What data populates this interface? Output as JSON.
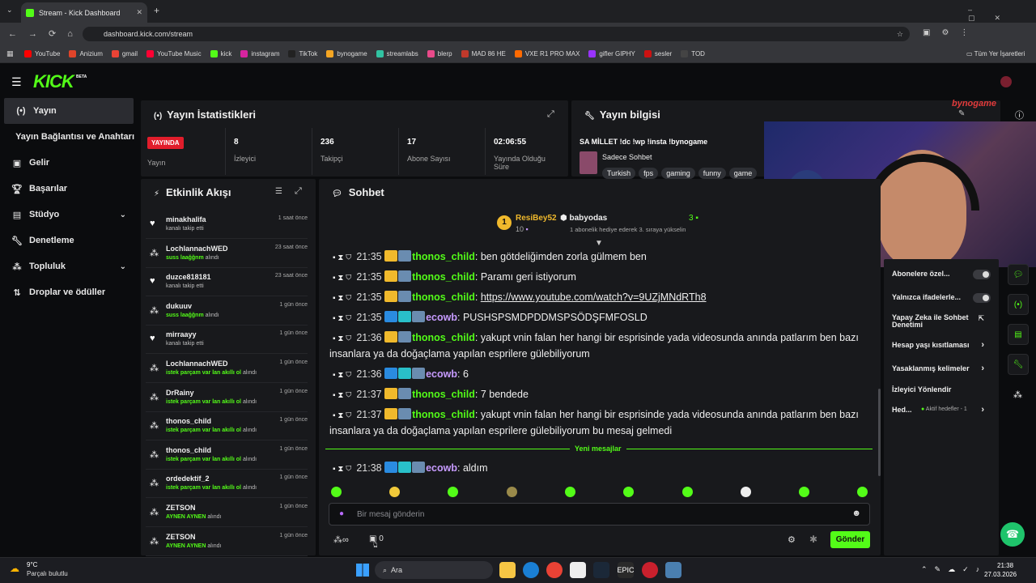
{
  "browser": {
    "tab_title": "Stream - Kick Dashboard",
    "url": "dashboard.kick.com/stream",
    "all_bookmarks": "Tüm Yer İşaretleri",
    "bookmarks": [
      {
        "label": "YouTube",
        "color": "#ff0000"
      },
      {
        "label": "Anizium",
        "color": "#e0442a"
      },
      {
        "label": "gmail",
        "color": "#ea4335"
      },
      {
        "label": "YouTube Music",
        "color": "#ff0033"
      },
      {
        "label": "kick",
        "color": "#53fc18"
      },
      {
        "label": "instagram",
        "color": "#d6249f"
      },
      {
        "label": "TikTok",
        "color": "#222222"
      },
      {
        "label": "bynogame",
        "color": "#f5a623"
      },
      {
        "label": "streamlabs",
        "color": "#31c3a2"
      },
      {
        "label": "blerp",
        "color": "#e94a8a"
      },
      {
        "label": "MAD 86 HE",
        "color": "#c0392b"
      },
      {
        "label": "VXE R1 PRO MAX",
        "color": "#ff6a00"
      },
      {
        "label": "gifler GIPHY",
        "color": "#9933ff"
      },
      {
        "label": "sesler",
        "color": "#cc1111"
      },
      {
        "label": "TOD",
        "color": "#444444"
      }
    ]
  },
  "app": {
    "logo": "KICK",
    "beta": "BETA"
  },
  "nav": [
    {
      "label": "Yayın",
      "icon": "stream-icon"
    },
    {
      "label": "Yayın Bağlantısı ve Anahtarı",
      "icon": ""
    },
    {
      "label": "Gelir",
      "icon": "revenue-icon"
    },
    {
      "label": "Başarılar",
      "icon": "trophy-icon"
    },
    {
      "label": "Stüdyo",
      "icon": "studio-icon"
    },
    {
      "label": "Denetleme",
      "icon": "wrench-icon"
    },
    {
      "label": "Topluluk",
      "icon": "community-icon"
    },
    {
      "label": "Droplar ve ödüller",
      "icon": "drops-icon"
    }
  ],
  "stats": {
    "title": "Yayın İstatistikleri",
    "live_badge": "YAYINDA",
    "live_label": "Yayın",
    "cells": [
      {
        "value": "8",
        "label": "İzleyici"
      },
      {
        "value": "236",
        "label": "Takipçi"
      },
      {
        "value": "17",
        "label": "Abone Sayısı"
      },
      {
        "value": "02:06:55",
        "label": "Yayında Olduğu Süre"
      }
    ]
  },
  "info": {
    "title": "Yayın bilgisi",
    "stream_title": "SA MİLLET !dc !wp !insta !bynogame",
    "category": "Sadece Sohbet",
    "tags": [
      "Turkish",
      "fps",
      "gaming",
      "funny",
      "game"
    ]
  },
  "activity": {
    "title": "Etkinlik Akışı",
    "items": [
      {
        "name": "minakhalifa",
        "detail": "kanalı takip etti",
        "highlight": "",
        "suffix": "",
        "time": "1 saat önce",
        "icon": "heart-icon"
      },
      {
        "name": "LochlannachWED",
        "detail": "",
        "highlight": "suss laağğnm",
        "suffix": " alındı",
        "time": "23 saat önce",
        "icon": "redeem-icon"
      },
      {
        "name": "duzce818181",
        "detail": "kanalı takip etti",
        "highlight": "",
        "suffix": "",
        "time": "23 saat önce",
        "icon": "heart-icon"
      },
      {
        "name": "dukuuv",
        "detail": "",
        "highlight": "suss laağğnm",
        "suffix": " alındı",
        "time": "1 gün önce",
        "icon": "redeem-icon"
      },
      {
        "name": "mirraayy",
        "detail": "kanalı takip etti",
        "highlight": "",
        "suffix": "",
        "time": "1 gün önce",
        "icon": "heart-icon"
      },
      {
        "name": "LochlannachWED",
        "detail": "",
        "highlight": "istek parçam var lan akıllı ol",
        "suffix": " alındı",
        "time": "1 gün önce",
        "icon": "redeem-icon"
      },
      {
        "name": "DrRainy",
        "detail": "",
        "highlight": "istek parçam var lan akıllı ol",
        "suffix": " alındı",
        "time": "1 gün önce",
        "icon": "redeem-icon"
      },
      {
        "name": "thonos_child",
        "detail": "",
        "highlight": "istek parçam var lan akıllı ol",
        "suffix": " alındı",
        "time": "1 gün önce",
        "icon": "redeem-icon"
      },
      {
        "name": "thonos_child",
        "detail": "",
        "highlight": "istek parçam var lan akıllı ol",
        "suffix": " alındı",
        "time": "1 gün önce",
        "icon": "redeem-icon"
      },
      {
        "name": "ordedektif_2",
        "detail": "",
        "highlight": "istek parçam var lan akıllı ol",
        "suffix": " alındı",
        "time": "1 gün önce",
        "icon": "redeem-icon"
      },
      {
        "name": "ZETSON",
        "detail": "",
        "highlight": "AYNEN AYNEN",
        "suffix": " alındı",
        "time": "1 gün önce",
        "icon": "redeem-icon"
      },
      {
        "name": "ZETSON",
        "detail": "",
        "highlight": "AYNEN AYNEN",
        "suffix": " alındı",
        "time": "1 gün önce",
        "icon": "redeem-icon"
      }
    ]
  },
  "chat": {
    "title": "Sohbet",
    "gift_leader": {
      "rank": "1",
      "name": "ResiBey52",
      "count": "10"
    },
    "gift_event": {
      "name": "babyodas",
      "count": "3",
      "text": "1 abonelik hediye ederek 3. sıraya yükselin"
    },
    "messages": [
      {
        "time": "21:35",
        "user": "thonos_child",
        "color": "g",
        "text": "ben götdeliğimden zorla gülmem ben",
        "link": false
      },
      {
        "time": "21:35",
        "user": "thonos_child",
        "color": "g",
        "text": "Paramı geri istiyorum",
        "link": false
      },
      {
        "time": "21:35",
        "user": "thonos_child",
        "color": "g",
        "text": "https://www.youtube.com/watch?v=9UZjMNdRTh8",
        "link": true
      },
      {
        "time": "21:35",
        "user": "ecowb",
        "color": "p",
        "text": "PUSHSPSMDPDDMSPSÖDŞFMFOSLD",
        "link": false
      },
      {
        "time": "21:36",
        "user": "thonos_child",
        "color": "g",
        "text": "yakupt vnin falan her hangi bir esprisinde yada videosunda anında patlarım ben bazı insanlara ya da doğaçlama yapılan esprilere gülebiliyorum",
        "link": false
      },
      {
        "time": "21:36",
        "user": "ecowb",
        "color": "p",
        "text": "6",
        "link": false
      },
      {
        "time": "21:37",
        "user": "thonos_child",
        "color": "g",
        "text": "7 bendede",
        "link": false
      },
      {
        "time": "21:37",
        "user": "thonos_child",
        "color": "g",
        "text": "yakupt vnin falan her hangi bir esprisinde yada videosunda anında patlarım ben bazı insanlara ya da doğaçlama yapılan esprilere gülebiliyorum bu mesaj gelmedi",
        "link": false
      },
      {
        "time": "21:38",
        "user": "ecowb",
        "color": "p",
        "text": "aldım",
        "link": false
      }
    ],
    "new_messages": "Yeni mesajlar",
    "input_placeholder": "Bir mesaj gönderin",
    "points": "0",
    "send": "Gönder"
  },
  "settings": {
    "rows": [
      "Abonelere özel...",
      "Yalnızca ifadelerle...",
      "Yapay Zeka ile Sohbet Denetimi",
      "Hesap yaşı kısıtlaması",
      "Yasaklanmış kelimeler",
      "İzleyici Yönlendir",
      "Hed..."
    ],
    "goal_label": "Aktif hedefler - 1"
  },
  "overlay_logo": "bynogame",
  "taskbar": {
    "temp": "9°C",
    "weather": "Parçalı bulutlu",
    "search": "Ara",
    "time": "21:38",
    "date": "27.03.2026"
  }
}
